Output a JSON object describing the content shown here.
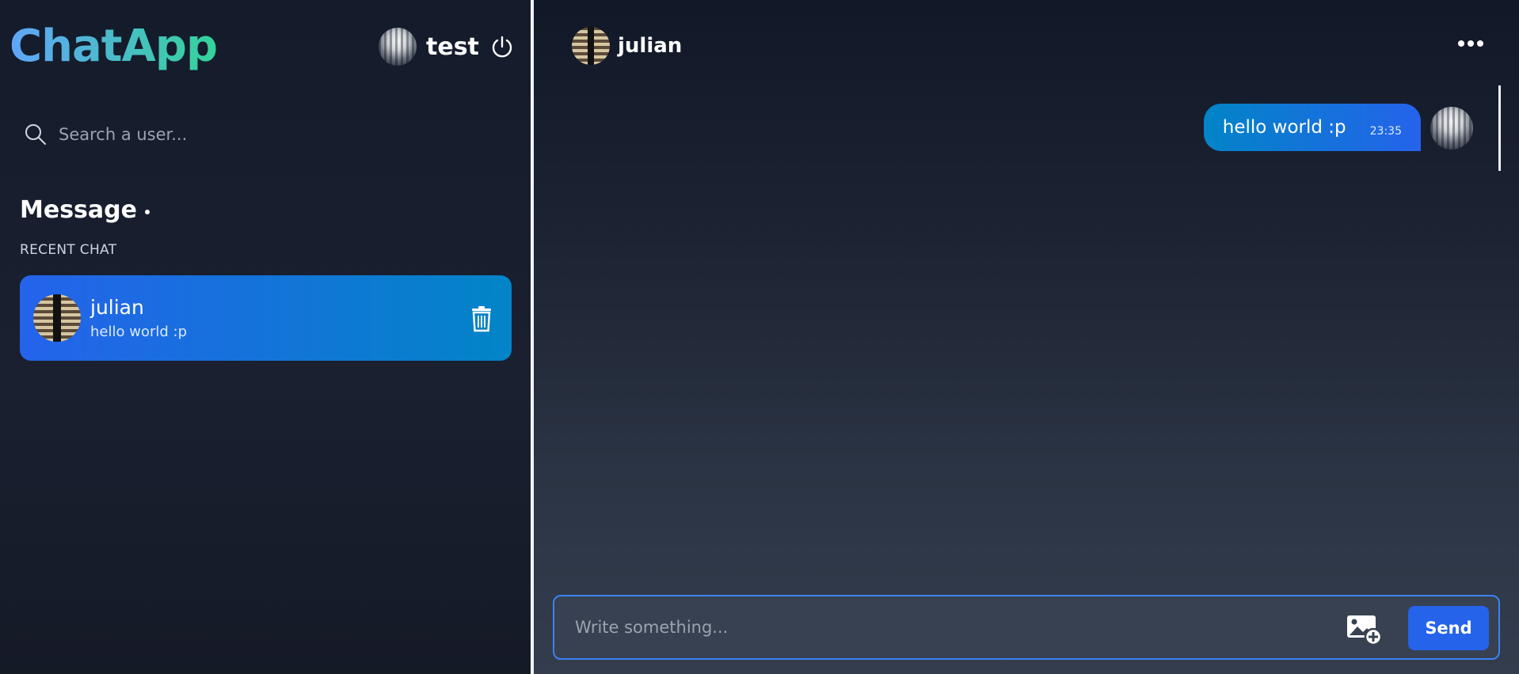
{
  "brand": {
    "name": "ChatApp"
  },
  "current_user": {
    "name": "test",
    "avatar_icon": "avatar-icon"
  },
  "search": {
    "placeholder": "Search a user..."
  },
  "sidebar": {
    "section_title": "Message",
    "recent_label": "RECENT CHAT",
    "chats": [
      {
        "name": "julian",
        "preview": "hello world :p"
      }
    ]
  },
  "conversation": {
    "contact_name": "julian",
    "messages": [
      {
        "text": "hello world :p",
        "time": "23:35",
        "from": "me"
      }
    ]
  },
  "composer": {
    "placeholder": "Write something...",
    "send_label": "Send"
  },
  "colors": {
    "accent": "#2563eb",
    "brand_gradient_start": "#60a5fa",
    "brand_gradient_end": "#34d399",
    "chat_item_gradient_end": "#0284c7"
  }
}
